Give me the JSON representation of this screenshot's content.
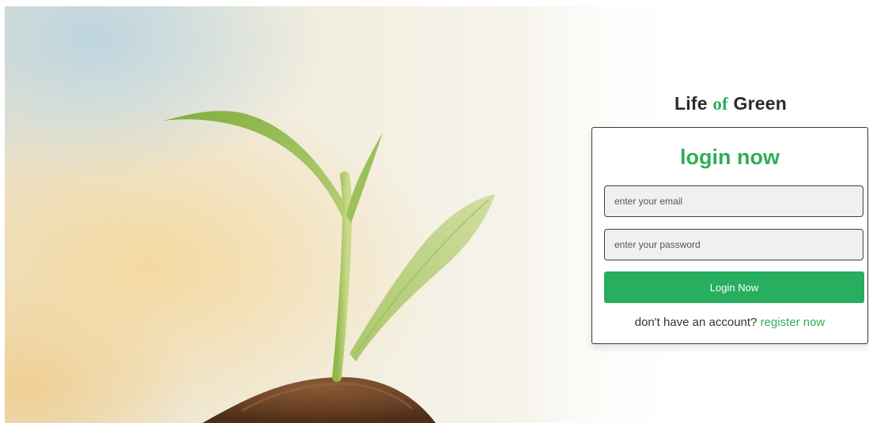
{
  "brand": {
    "part1": "Life",
    "part2": "of",
    "part3": "Green"
  },
  "login": {
    "title": "login now",
    "email_placeholder": "enter your email",
    "password_placeholder": "enter your password",
    "submit_label": "Login Now",
    "register_prompt": "don't have an account?",
    "register_link": "register now"
  },
  "colors": {
    "accent": "#2fae58",
    "button": "#27ae5f"
  },
  "icons": {
    "hero": "seedling-in-soil-illustration"
  }
}
